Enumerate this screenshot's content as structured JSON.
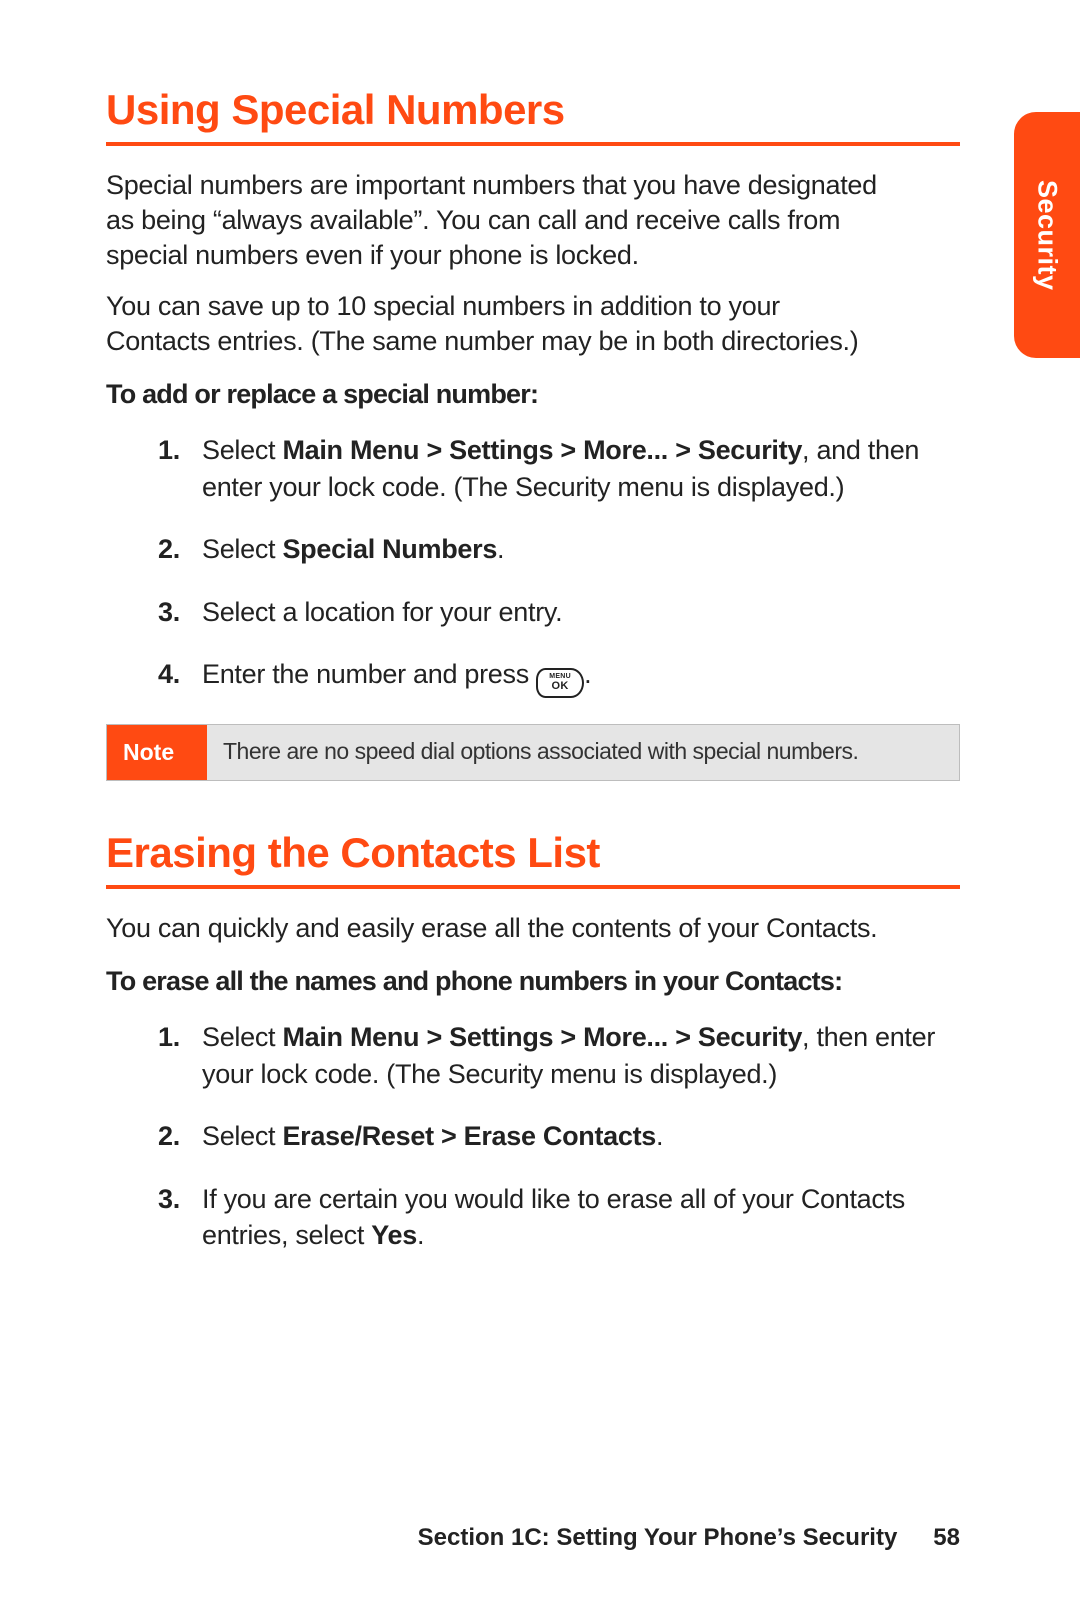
{
  "sideTab": "Security",
  "section1": {
    "heading": "Using Special Numbers",
    "para1": "Special numbers are important numbers that you have designated as being “always available”. You can call and receive calls from special numbers even if your phone is locked.",
    "para2": "You can save up to 10 special numbers in addition to your Contacts entries. (The same number may be in both directories.)",
    "subhead": "To add or replace a special number:",
    "steps": {
      "s1_a": "Select ",
      "s1_b": "Main Menu > Settings > More... > Security",
      "s1_c": ", and then enter your lock code. (The Security menu is displayed.)",
      "s2_a": "Select ",
      "s2_b": "Special Numbers",
      "s2_c": ".",
      "s3": "Select a location for your entry.",
      "s4_a": "Enter the number and press ",
      "s4_c": "."
    },
    "noteLabel": "Note",
    "noteText": "There are no speed dial options associated with special numbers."
  },
  "section2": {
    "heading": "Erasing the Contacts List",
    "para1": "You can quickly and easily erase all the contents of your Contacts.",
    "subhead": "To erase all the names and phone numbers in your Contacts:",
    "steps": {
      "s1_a": "Select ",
      "s1_b": "Main Menu > Settings > More... > Security",
      "s1_c": ", then enter your lock code. (The Security menu is displayed.)",
      "s2_a": "Select ",
      "s2_b": "Erase/Reset > Erase Contacts",
      "s2_c": ".",
      "s3_a": "If you are certain you would like to erase all of your Contacts entries, select ",
      "s3_b": "Yes",
      "s3_c": "."
    }
  },
  "footer": {
    "text": "Section 1C: Setting Your Phone’s Security",
    "page": "58"
  },
  "iconKeyTop": "MENU",
  "iconKeyBottom": "OK"
}
